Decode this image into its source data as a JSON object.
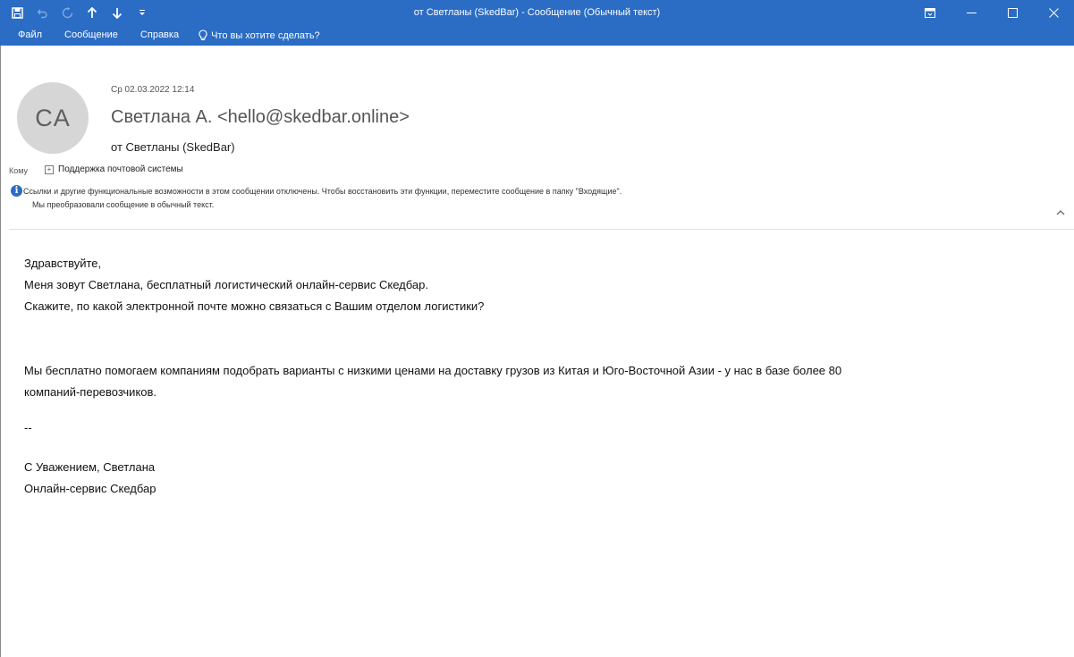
{
  "window": {
    "title": "от Светланы (SkedBar)  -  Сообщение (Обычный текст)"
  },
  "quick_access": {
    "icons": [
      "save-icon",
      "undo-icon",
      "redo-icon",
      "up-arrow-icon",
      "down-arrow-icon",
      "customize-icon"
    ]
  },
  "menu": {
    "file": "Файл",
    "message": "Сообщение",
    "help": "Справка",
    "tell_me": "Что вы хотите сделать?"
  },
  "header": {
    "avatar_initials": "CA",
    "date": "Ср 02.03.2022 12:14",
    "sender": "Светлана А. <hello@skedbar.online>",
    "subject": "от Светланы (SkedBar)",
    "to_label": "Кому",
    "to_value": "Поддержка почтовой системы",
    "info_line1": "Ссылки и другие функциональные возможности в этом сообщении отключены. Чтобы восстановить эти функции, переместите сообщение в папку \"Входящие\".",
    "info_line2": "Мы преобразовали сообщение в обычный текст."
  },
  "body": {
    "line1": "Здравствуйте,",
    "line2": "Меня зовут Светлана, бесплатный логистический онлайн-сервис Скедбар.",
    "line3": "Скажите, по какой электронной почте можно связаться с Вашим отделом логистики?",
    "line4": "Мы бесплатно помогаем компаниям подобрать варианты с низкими ценами на доставку грузов из Китая и Юго-Восточной Азии - у нас в базе более 80",
    "line5": "компаний-перевозчиков.",
    "line6": "--",
    "line7": "С Уважением, Светлана",
    "line8": "Онлайн-сервис Скедбар"
  },
  "colors": {
    "titlebar": "#2b6cc4",
    "avatar_bg": "#d6d6d6"
  }
}
